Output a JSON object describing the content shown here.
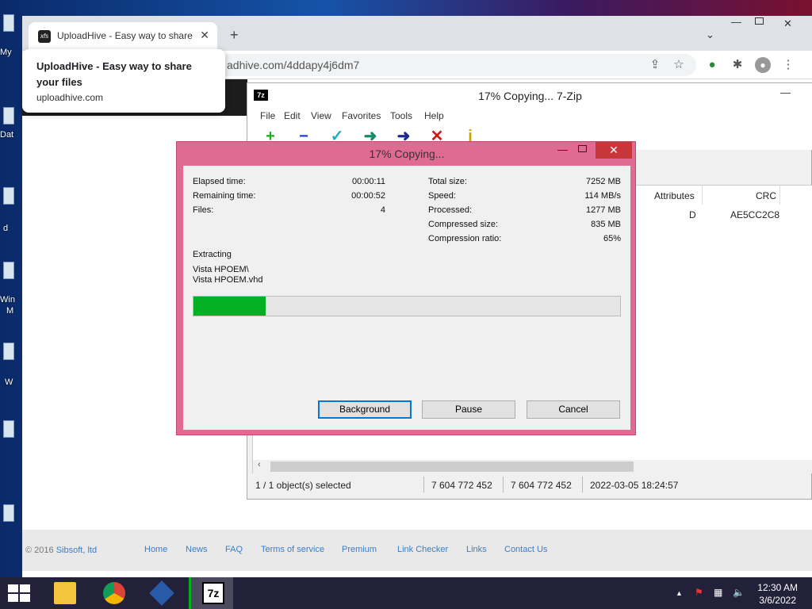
{
  "desktop": {
    "labels": [
      "My",
      "Dat",
      "d",
      "Win",
      "M",
      "W"
    ]
  },
  "browser": {
    "tab_title": "UploadHive - Easy way to share y",
    "tab_favicon": "xfs",
    "url": "adhive.com/4ddapy4j6dm7",
    "tooltip": {
      "title": "UploadHive - Easy way to share your files",
      "url": "uploadhive.com"
    },
    "footer": {
      "copyright_prefix": "© 2016 ",
      "copyright_link": "Sibsoft, ltd",
      "links": [
        "Home",
        "News",
        "FAQ",
        "Terms of service",
        "Premium",
        "Link Checker",
        "Links",
        "Contact Us"
      ]
    }
  },
  "zip": {
    "title": "17% Copying... 7-Zip",
    "logo": "7z",
    "menu": [
      "File",
      "Edit",
      "View",
      "Favorites",
      "Tools",
      "Help"
    ],
    "columns": {
      "attributes": "Attributes",
      "crc": "CRC"
    },
    "row": {
      "attributes": "D",
      "crc": "AE5CC2C8"
    },
    "status": {
      "selected": "1 / 1 object(s) selected",
      "size": "7 604 772 452",
      "packed": "7 604 772 452",
      "modified": "2022-03-05 18:24:57"
    }
  },
  "dialog": {
    "title": "17% Copying...",
    "elapsed_label": "Elapsed time:",
    "elapsed": "00:00:11",
    "remaining_label": "Remaining time:",
    "remaining": "00:00:52",
    "files_label": "Files:",
    "files": "4",
    "total_label": "Total size:",
    "total": "7252 MB",
    "speed_label": "Speed:",
    "speed": "114 MB/s",
    "processed_label": "Processed:",
    "processed": "1277 MB",
    "compressed_label": "Compressed size:",
    "compressed": "835 MB",
    "ratio_label": "Compression ratio:",
    "ratio": "65%",
    "action": "Extracting",
    "path_line1": "Vista HPOEM\\",
    "path_line2": "Vista HPOEM.vhd",
    "progress_percent": 17,
    "buttons": {
      "background": "Background",
      "pause": "Pause",
      "cancel": "Cancel"
    }
  },
  "taskbar": {
    "clock_time": "12:30 AM",
    "clock_date": "3/6/2022",
    "apps": [
      "file-explorer-icon",
      "chrome-icon",
      "virtualbox-icon",
      "7zip-icon"
    ],
    "active_label": "7z"
  },
  "colors": {
    "dialog_frame": "#e06b92",
    "progress_fill": "#06b025",
    "close_red": "#c7373a",
    "taskbar": "#23213a",
    "link": "#3c7dc4"
  }
}
